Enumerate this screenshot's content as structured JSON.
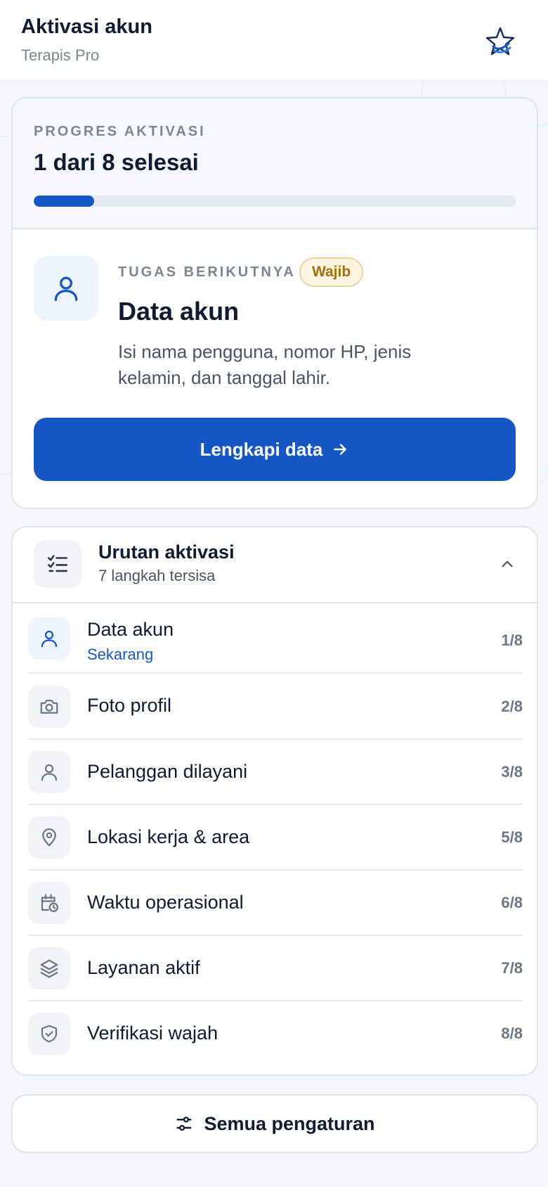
{
  "header": {
    "title": "Aktivasi akun",
    "subtitle": "Terapis Pro",
    "logo_icon": "brand-star-logo"
  },
  "progress": {
    "eyebrow": "PROGRES AKTIVASI",
    "count_text": "1 dari 8 selesai",
    "completed": 1,
    "total": 8
  },
  "next_task": {
    "eyebrow": "TUGAS BERIKUTNYA",
    "badge": "Wajib",
    "title": "Data akun",
    "description": "Isi nama pengguna, nomor HP, jenis kelamin, dan tanggal lahir.",
    "button_label": "Lengkapi data",
    "icon": "user-icon"
  },
  "steps": {
    "title": "Urutan aktivasi",
    "subtitle": "7 langkah tersisa",
    "items": [
      {
        "label": "Data akun",
        "status": "Sekarang",
        "number": "1/8",
        "icon": "user-icon"
      },
      {
        "label": "Foto profil",
        "number": "2/8",
        "icon": "camera-icon"
      },
      {
        "label": "Pelanggan dilayani",
        "number": "3/8",
        "icon": "user-icon"
      },
      {
        "label": "Lokasi kerja & area",
        "number": "5/8",
        "icon": "map-pin-icon"
      },
      {
        "label": "Waktu operasional",
        "number": "6/8",
        "icon": "calendar-clock-icon"
      },
      {
        "label": "Layanan aktif",
        "number": "7/8",
        "icon": "layers-icon"
      },
      {
        "label": "Verifikasi wajah",
        "number": "8/8",
        "icon": "shield-check-icon"
      }
    ]
  },
  "footer": {
    "all_settings_label": "Semua pengaturan",
    "icon": "sliders-icon"
  },
  "colors": {
    "accent": "#1656c4",
    "badge_bg": "#fdf5e1",
    "badge_text": "#a1700e",
    "track": "#e6e9ef"
  }
}
